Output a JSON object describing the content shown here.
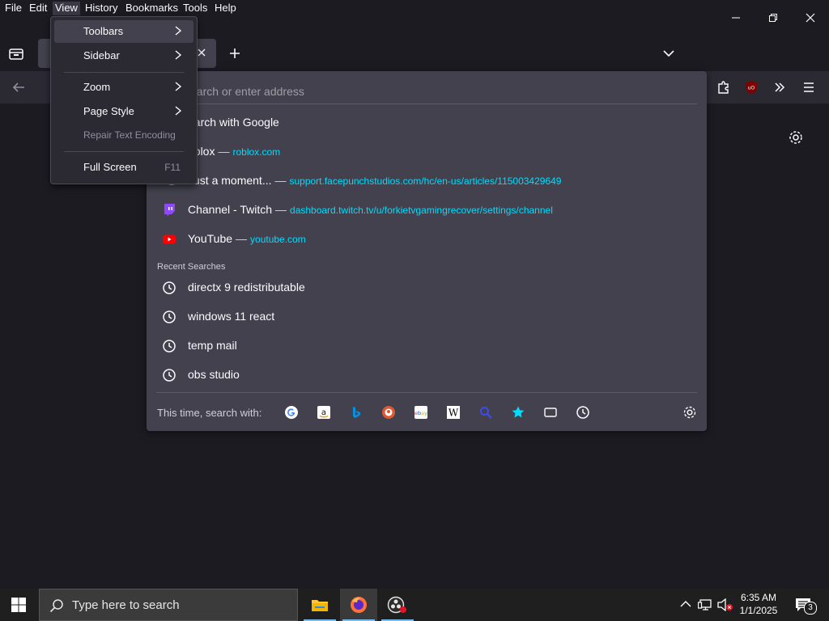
{
  "menubar": {
    "items": [
      "File",
      "Edit",
      "View",
      "History",
      "Bookmarks",
      "Tools",
      "Help"
    ]
  },
  "url_dropdown": {
    "placeholder": "Search or enter address",
    "visible_placeholder": "earch or enter address",
    "search_with_google": "earch with Google",
    "suggestions": [
      {
        "title": "oblox",
        "url": "roblox.com"
      },
      {
        "title": "Just a moment...",
        "url": "support.facepunchstudios.com/hc/en-us/articles/115003429649"
      },
      {
        "title": "Channel - Twitch",
        "url": "dashboard.twitch.tv/u/forkietvgamingrecover/settings/channel"
      },
      {
        "title": "YouTube",
        "url": "youtube.com"
      }
    ],
    "dash": "—",
    "recent_label": "Recent Searches",
    "recent": [
      "directx 9 redistributable",
      "windows 11 react",
      "temp mail",
      "obs studio"
    ],
    "search_with_label": "This time, search with:"
  },
  "view_menu": {
    "items": [
      {
        "label": "Toolbars",
        "submenu": true
      },
      {
        "label": "Sidebar",
        "submenu": true
      },
      {
        "label": "Zoom",
        "submenu": true
      },
      {
        "label": "Page Style",
        "submenu": true
      },
      {
        "label": "Repair Text Encoding",
        "disabled": true
      },
      {
        "label": "Full Screen",
        "accel": "F11"
      }
    ]
  },
  "taskbar": {
    "search_placeholder": "Type here to search",
    "time": "6:35 AM",
    "date": "1/1/2025",
    "notification_count": "3"
  },
  "colors": {
    "accent_url": "#00ddff",
    "panel_bg": "#42414d",
    "menu_bg": "#2b2a33",
    "window_bg": "#1c1b22"
  }
}
